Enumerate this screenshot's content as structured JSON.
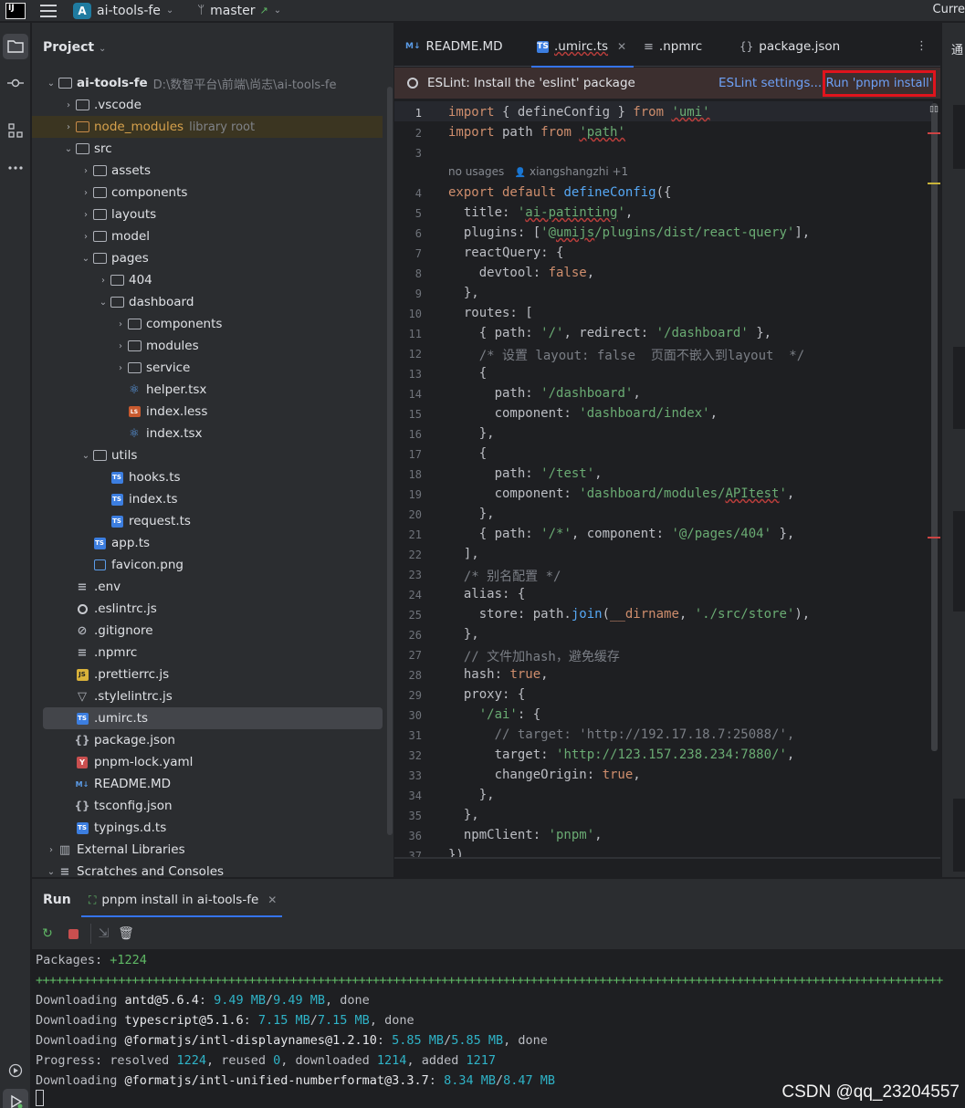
{
  "topbar": {
    "app_logo": "IJ",
    "project_badge": "A",
    "project_name": "ai-tools-fe",
    "branch": "master",
    "right_text": "Curre"
  },
  "project_panel": {
    "title": "Project",
    "root_name": "ai-tools-fe",
    "root_path": "D:\\数智平台\\前端\\尚志\\ai-tools-fe",
    "node_modules_hint": "library root",
    "items": {
      "vscode": ".vscode",
      "node_modules": "node_modules",
      "src": "src",
      "assets": "assets",
      "components": "components",
      "layouts": "layouts",
      "model": "model",
      "pages": "pages",
      "p404": "404",
      "dashboard": "dashboard",
      "d_components": "components",
      "d_modules": "modules",
      "d_service": "service",
      "helper": "helper.tsx",
      "index_less": "index.less",
      "index_tsx": "index.tsx",
      "utils": "utils",
      "hooks": "hooks.ts",
      "index_ts": "index.ts",
      "request": "request.ts",
      "app": "app.ts",
      "favicon": "favicon.png",
      "env": ".env",
      "eslintrc": ".eslintrc.js",
      "gitignore": ".gitignore",
      "npmrc": ".npmrc",
      "prettierrc": ".prettierrc.js",
      "stylelintrc": ".stylelintrc.js",
      "umirc": ".umirc.ts",
      "package": "package.json",
      "pnpmlock": "pnpm-lock.yaml",
      "readme": "README.MD",
      "tsconfig": "tsconfig.json",
      "typings": "typings.d.ts",
      "external": "External Libraries",
      "scratches": "Scratches and Consoles"
    }
  },
  "editor": {
    "tabs": [
      {
        "label": "README.MD",
        "icon": "M↓"
      },
      {
        "label": ".umirc.ts",
        "icon": "TS"
      },
      {
        "label": ".npmrc",
        "icon": "≡"
      },
      {
        "label": "package.json",
        "icon": "{}"
      }
    ],
    "eslint_banner": {
      "message": "ESLint: Install the 'eslint' package",
      "settings_link": "ESLint settings...",
      "run_button": "Run 'pnpm install'"
    },
    "inlay_hint": "no usages",
    "inlay_author": "xiangshangzhi +1",
    "line_numbers": [
      "1",
      "2",
      "3",
      "4",
      "5",
      "6",
      "7",
      "8",
      "9",
      "10",
      "11",
      "12",
      "13",
      "14",
      "15",
      "16",
      "17",
      "18",
      "19",
      "20",
      "21",
      "22",
      "23",
      "24",
      "25",
      "26",
      "27",
      "28",
      "29",
      "30",
      "31",
      "32",
      "33",
      "34",
      "35",
      "36",
      "37"
    ]
  },
  "right_panel": {
    "text": "通"
  },
  "run_panel": {
    "title": "Run",
    "tab_label": "pnpm install in ai-tools-fe",
    "console": {
      "packages_label": "Packages: ",
      "packages_value": "+1224",
      "progress_bar": "++++++++++++++++++++++++++++++++++++++++++++++++++++++++++++++++++++++++++++++++++++++++++++++++++++++++++++++++++++++++++++++++++++",
      "dl1_prefix": "Downloading ",
      "dl1_pkg": "antd@5.6.4",
      "dl1_sep": ": ",
      "dl1_a": "9.49 MB",
      "dl1_b": "9.49 MB",
      "dl1_tail": ", done",
      "dl2_prefix": "Downloading ",
      "dl2_pkg": "typescript@5.1.6",
      "dl2_sep": ": ",
      "dl2_a": "7.15 MB",
      "dl2_b": "7.15 MB",
      "dl2_tail": ", done",
      "dl3_prefix": "Downloading ",
      "dl3_pkg": "@formatjs/intl-displaynames@1.2.10",
      "dl3_sep": ": ",
      "dl3_a": "5.85 MB",
      "dl3_b": "5.85 MB",
      "dl3_tail": ", done",
      "prog_prefix": "Progress: resolved ",
      "prog_resolved": "1224",
      "prog_reused_l": ", reused ",
      "prog_reused": "0",
      "prog_dl_l": ", downloaded ",
      "prog_dl": "1214",
      "prog_added_l": ", added ",
      "prog_added": "1217",
      "dl4_prefix": "Downloading ",
      "dl4_pkg": "@formatjs/intl-unified-numberformat@3.3.7",
      "dl4_sep": ": ",
      "dl4_a": "8.34 MB",
      "dl4_b": "8.47 MB"
    }
  },
  "watermark": "CSDN @qq_23204557",
  "colors": {
    "accent": "#3574f0",
    "banner_bg": "#3c2f2f",
    "highlight_border": "#e0141d",
    "keyword": "#cf8e6d",
    "string": "#6aab73"
  }
}
